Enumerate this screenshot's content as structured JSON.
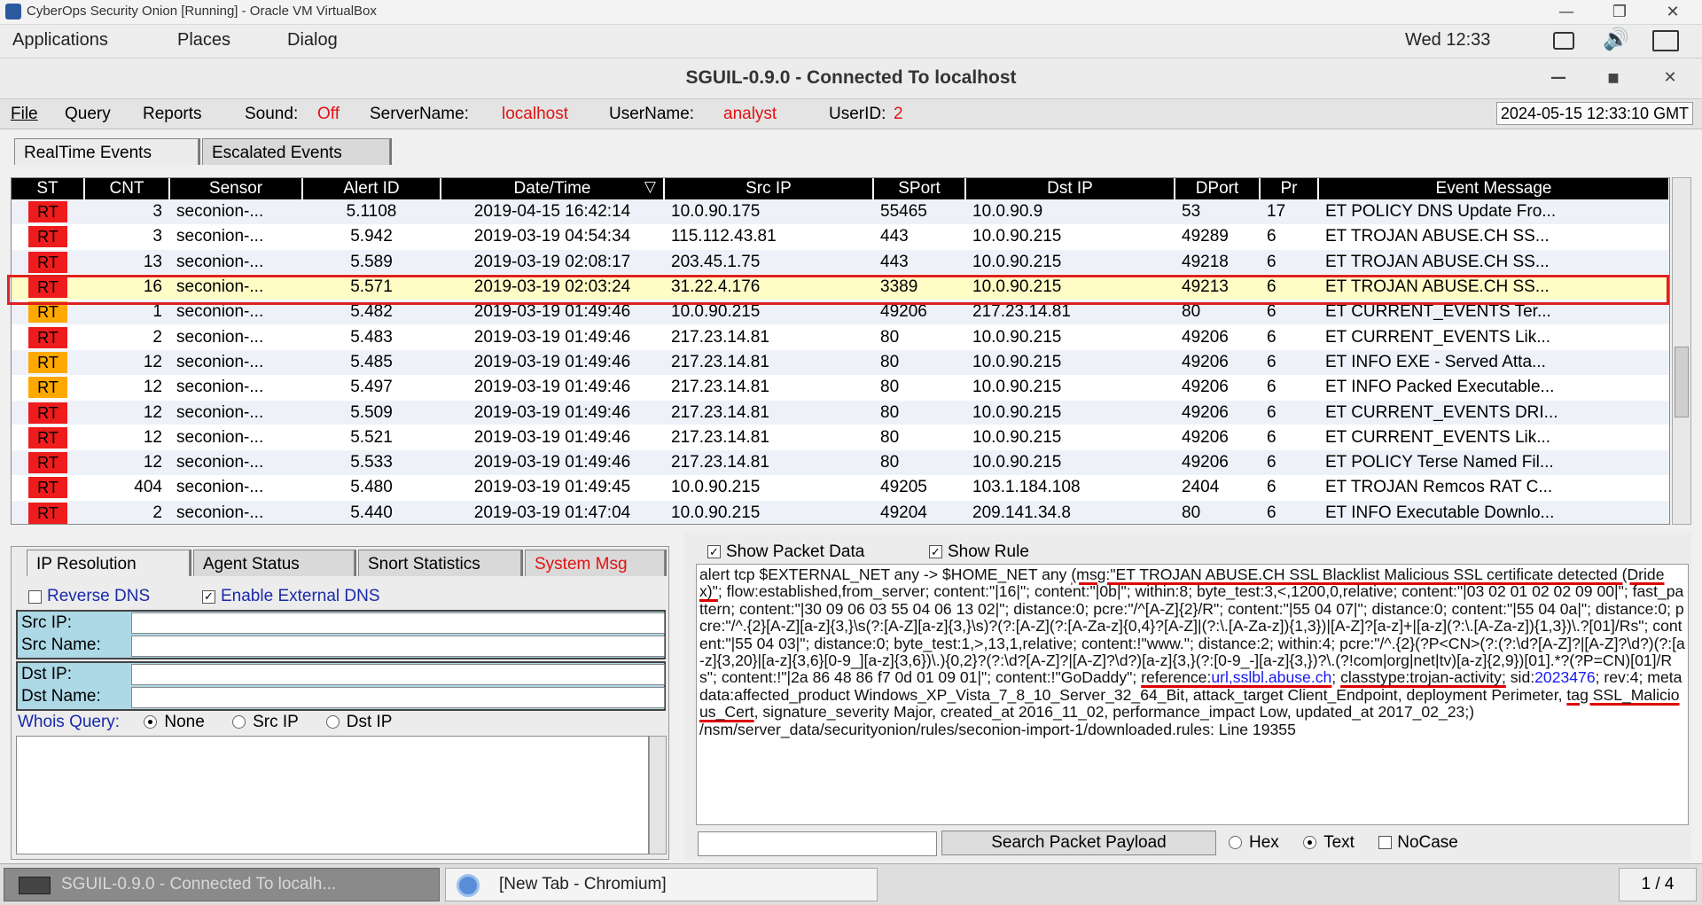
{
  "vbox": {
    "title": "CyberOps Security Onion [Running] - Oracle VM VirtualBox"
  },
  "gnome": {
    "menus": [
      "Applications",
      "Places",
      "Dialog"
    ],
    "clock": "Wed 12:33"
  },
  "sguil": {
    "title": "SGUIL-0.9.0 - Connected To localhost",
    "menu": {
      "file": "File",
      "query": "Query",
      "reports": "Reports"
    },
    "status": {
      "sound_label": "Sound:",
      "sound_value": "Off",
      "server_label": "ServerName:",
      "server_value": "localhost",
      "user_label": "UserName:",
      "user_value": "analyst",
      "userid_label": "UserID:",
      "userid_value": "2"
    },
    "datetime": "2024-05-15 12:33:10 GMT",
    "tabs": [
      "RealTime Events",
      "Escalated Events"
    ],
    "columns": [
      "ST",
      "CNT",
      "Sensor",
      "Alert ID",
      "Date/Time",
      "Src IP",
      "SPort",
      "Dst IP",
      "DPort",
      "Pr",
      "Event Message"
    ],
    "rows": [
      {
        "st": "RT",
        "color": "red",
        "cnt": "3",
        "sensor": "seconion-...",
        "alert": "5.1108",
        "dt": "2019-04-15 16:42:14",
        "src": "10.0.90.175",
        "sport": "55465",
        "dst": "10.0.90.9",
        "dport": "53",
        "pr": "17",
        "msg": "ET POLICY DNS Update Fro..."
      },
      {
        "st": "RT",
        "color": "red",
        "cnt": "3",
        "sensor": "seconion-...",
        "alert": "5.942",
        "dt": "2019-03-19 04:54:34",
        "src": "115.112.43.81",
        "sport": "443",
        "dst": "10.0.90.215",
        "dport": "49289",
        "pr": "6",
        "msg": "ET TROJAN ABUSE.CH SS..."
      },
      {
        "st": "RT",
        "color": "red",
        "cnt": "13",
        "sensor": "seconion-...",
        "alert": "5.589",
        "dt": "2019-03-19 02:08:17",
        "src": "203.45.1.75",
        "sport": "443",
        "dst": "10.0.90.215",
        "dport": "49218",
        "pr": "6",
        "msg": "ET TROJAN ABUSE.CH SS..."
      },
      {
        "st": "RT",
        "color": "red",
        "cnt": "16",
        "sensor": "seconion-...",
        "alert": "5.571",
        "dt": "2019-03-19 02:03:24",
        "src": "31.22.4.176",
        "sport": "3389",
        "dst": "10.0.90.215",
        "dport": "49213",
        "pr": "6",
        "msg": "ET TROJAN ABUSE.CH SS...",
        "selected": true
      },
      {
        "st": "RT",
        "color": "orange",
        "cnt": "1",
        "sensor": "seconion-...",
        "alert": "5.482",
        "dt": "2019-03-19 01:49:46",
        "src": "10.0.90.215",
        "sport": "49206",
        "dst": "217.23.14.81",
        "dport": "80",
        "pr": "6",
        "msg": "ET CURRENT_EVENTS Ter..."
      },
      {
        "st": "RT",
        "color": "red",
        "cnt": "2",
        "sensor": "seconion-...",
        "alert": "5.483",
        "dt": "2019-03-19 01:49:46",
        "src": "217.23.14.81",
        "sport": "80",
        "dst": "10.0.90.215",
        "dport": "49206",
        "pr": "6",
        "msg": "ET CURRENT_EVENTS Lik..."
      },
      {
        "st": "RT",
        "color": "orange",
        "cnt": "12",
        "sensor": "seconion-...",
        "alert": "5.485",
        "dt": "2019-03-19 01:49:46",
        "src": "217.23.14.81",
        "sport": "80",
        "dst": "10.0.90.215",
        "dport": "49206",
        "pr": "6",
        "msg": "ET INFO EXE - Served Atta..."
      },
      {
        "st": "RT",
        "color": "orange",
        "cnt": "12",
        "sensor": "seconion-...",
        "alert": "5.497",
        "dt": "2019-03-19 01:49:46",
        "src": "217.23.14.81",
        "sport": "80",
        "dst": "10.0.90.215",
        "dport": "49206",
        "pr": "6",
        "msg": "ET INFO Packed Executable..."
      },
      {
        "st": "RT",
        "color": "red",
        "cnt": "12",
        "sensor": "seconion-...",
        "alert": "5.509",
        "dt": "2019-03-19 01:49:46",
        "src": "217.23.14.81",
        "sport": "80",
        "dst": "10.0.90.215",
        "dport": "49206",
        "pr": "6",
        "msg": "ET CURRENT_EVENTS DRI..."
      },
      {
        "st": "RT",
        "color": "red",
        "cnt": "12",
        "sensor": "seconion-...",
        "alert": "5.521",
        "dt": "2019-03-19 01:49:46",
        "src": "217.23.14.81",
        "sport": "80",
        "dst": "10.0.90.215",
        "dport": "49206",
        "pr": "6",
        "msg": "ET CURRENT_EVENTS Lik..."
      },
      {
        "st": "RT",
        "color": "red",
        "cnt": "12",
        "sensor": "seconion-...",
        "alert": "5.533",
        "dt": "2019-03-19 01:49:46",
        "src": "217.23.14.81",
        "sport": "80",
        "dst": "10.0.90.215",
        "dport": "49206",
        "pr": "6",
        "msg": "ET POLICY Terse Named Fil..."
      },
      {
        "st": "RT",
        "color": "red",
        "cnt": "404",
        "sensor": "seconion-...",
        "alert": "5.480",
        "dt": "2019-03-19 01:49:45",
        "src": "10.0.90.215",
        "sport": "49205",
        "dst": "103.1.184.108",
        "dport": "2404",
        "pr": "6",
        "msg": "ET TROJAN Remcos RAT C..."
      },
      {
        "st": "RT",
        "color": "red",
        "cnt": "2",
        "sensor": "seconion-...",
        "alert": "5.440",
        "dt": "2019-03-19 01:47:04",
        "src": "10.0.90.215",
        "sport": "49204",
        "dst": "209.141.34.8",
        "dport": "80",
        "pr": "6",
        "msg": "ET INFO Executable Downlo..."
      }
    ],
    "lower_tabs": [
      "IP Resolution",
      "Agent Status",
      "Snort Statistics",
      "System Msg"
    ],
    "reverse_dns": "Reverse DNS",
    "external_dns": "Enable External DNS",
    "src_ip_label": "Src IP:",
    "src_name_label": "Src Name:",
    "dst_ip_label": "Dst IP:",
    "dst_name_label": "Dst Name:",
    "whois_label": "Whois Query:",
    "whois_options": [
      "None",
      "Src IP",
      "Dst IP"
    ],
    "show_packet": "Show Packet Data",
    "show_rule": "Show Rule",
    "rule": {
      "p1": "alert tcp $EXTERNAL_NET any -> $HOME_NET any ",
      "u1": "(msg:\"ET TROJAN ABUSE.CH SSL Blacklist Malicious SSL certificate detected (Dridex)\"",
      "p2": "; flow:established,from_server; content:\"|16|\"; content:\"|0b|\"; within:8; byte_test:3,<,1200,0,relative; content:\"|03 02 01 02 02 09 00|\"; fast_pattern; content:\"|30 09 06 03 55 04 06 13 02|\"; distance:0; pcre:\"/^[A-Z]{2}/R\"; content:\"|55 04 07|\"; distance:0; content:\"|55 04 0a|\"; distance:0; pcre:\"/^.{2}[A-Z][a-z]{3,}\\s(?:[A-Z][a-z]{3,}\\s)?(?:[A-Z](?:[A-Za-z]{0,4}?[A-Z]|(?:\\.[A-Za-z]){1,3})|[A-Z]?[a-z]+|[a-z](?:\\.[A-Za-z]){1,3})\\.?[01]/Rs\"; content:\"|55 04 03|\"; distance:0; byte_test:1,>,13,1,relative; content:!\"www.\"; distance:2; within:4; pcre:\"/^.{2}(?P<CN>(?:(?:\\d?[A-Z]?|[A-Z]?\\d?)(?:[a-z]{3,20}|[a-z]{3,6}[0-9_][a-z]{3,6})\\.){0,2}?(?:\\d?[A-Z]?|[A-Z]?\\d?)[a-z]{3,}(?:[0-9_-][a-z]{3,})?\\.(?!com|org|net|tv)[a-z]{2,9})[01].*?(?P=CN)[01]/Rs\"; content:!\"|2a 86 48 86 f7 0d 01 09 01|\"; content:!\"GoDaddy\"; ",
      "ref_label": "reference:",
      "ref_link": "url,sslbl.abuse.ch",
      "p3": "; ",
      "classtype": "classtype:trojan-activity;",
      "sid_label": " sid:",
      "sid_link": "2023476",
      "p4": "; rev:4; metadata:affected_product Windows_XP_Vista_7_8_10_Server_32_64_Bit, attack_target Client_Endpoint, deployment Perimeter, ",
      "tag": "tag SSL_Malicious_Cert",
      "p5": ", signature_severity Major, created_at 2016_11_02, performance_impact Low, updated_at 2017_02_23;)",
      "path": "/nsm/server_data/securityonion/rules/seconion-import-1/downloaded.rules: Line 19355"
    },
    "search_button": "Search Packet Payload",
    "search_options": [
      "Hex",
      "Text",
      "NoCase"
    ]
  },
  "taskbar": {
    "task1": "SGUIL-0.9.0 - Connected To localh...",
    "task2": "[New Tab - Chromium]",
    "workspace": "1 / 4"
  }
}
